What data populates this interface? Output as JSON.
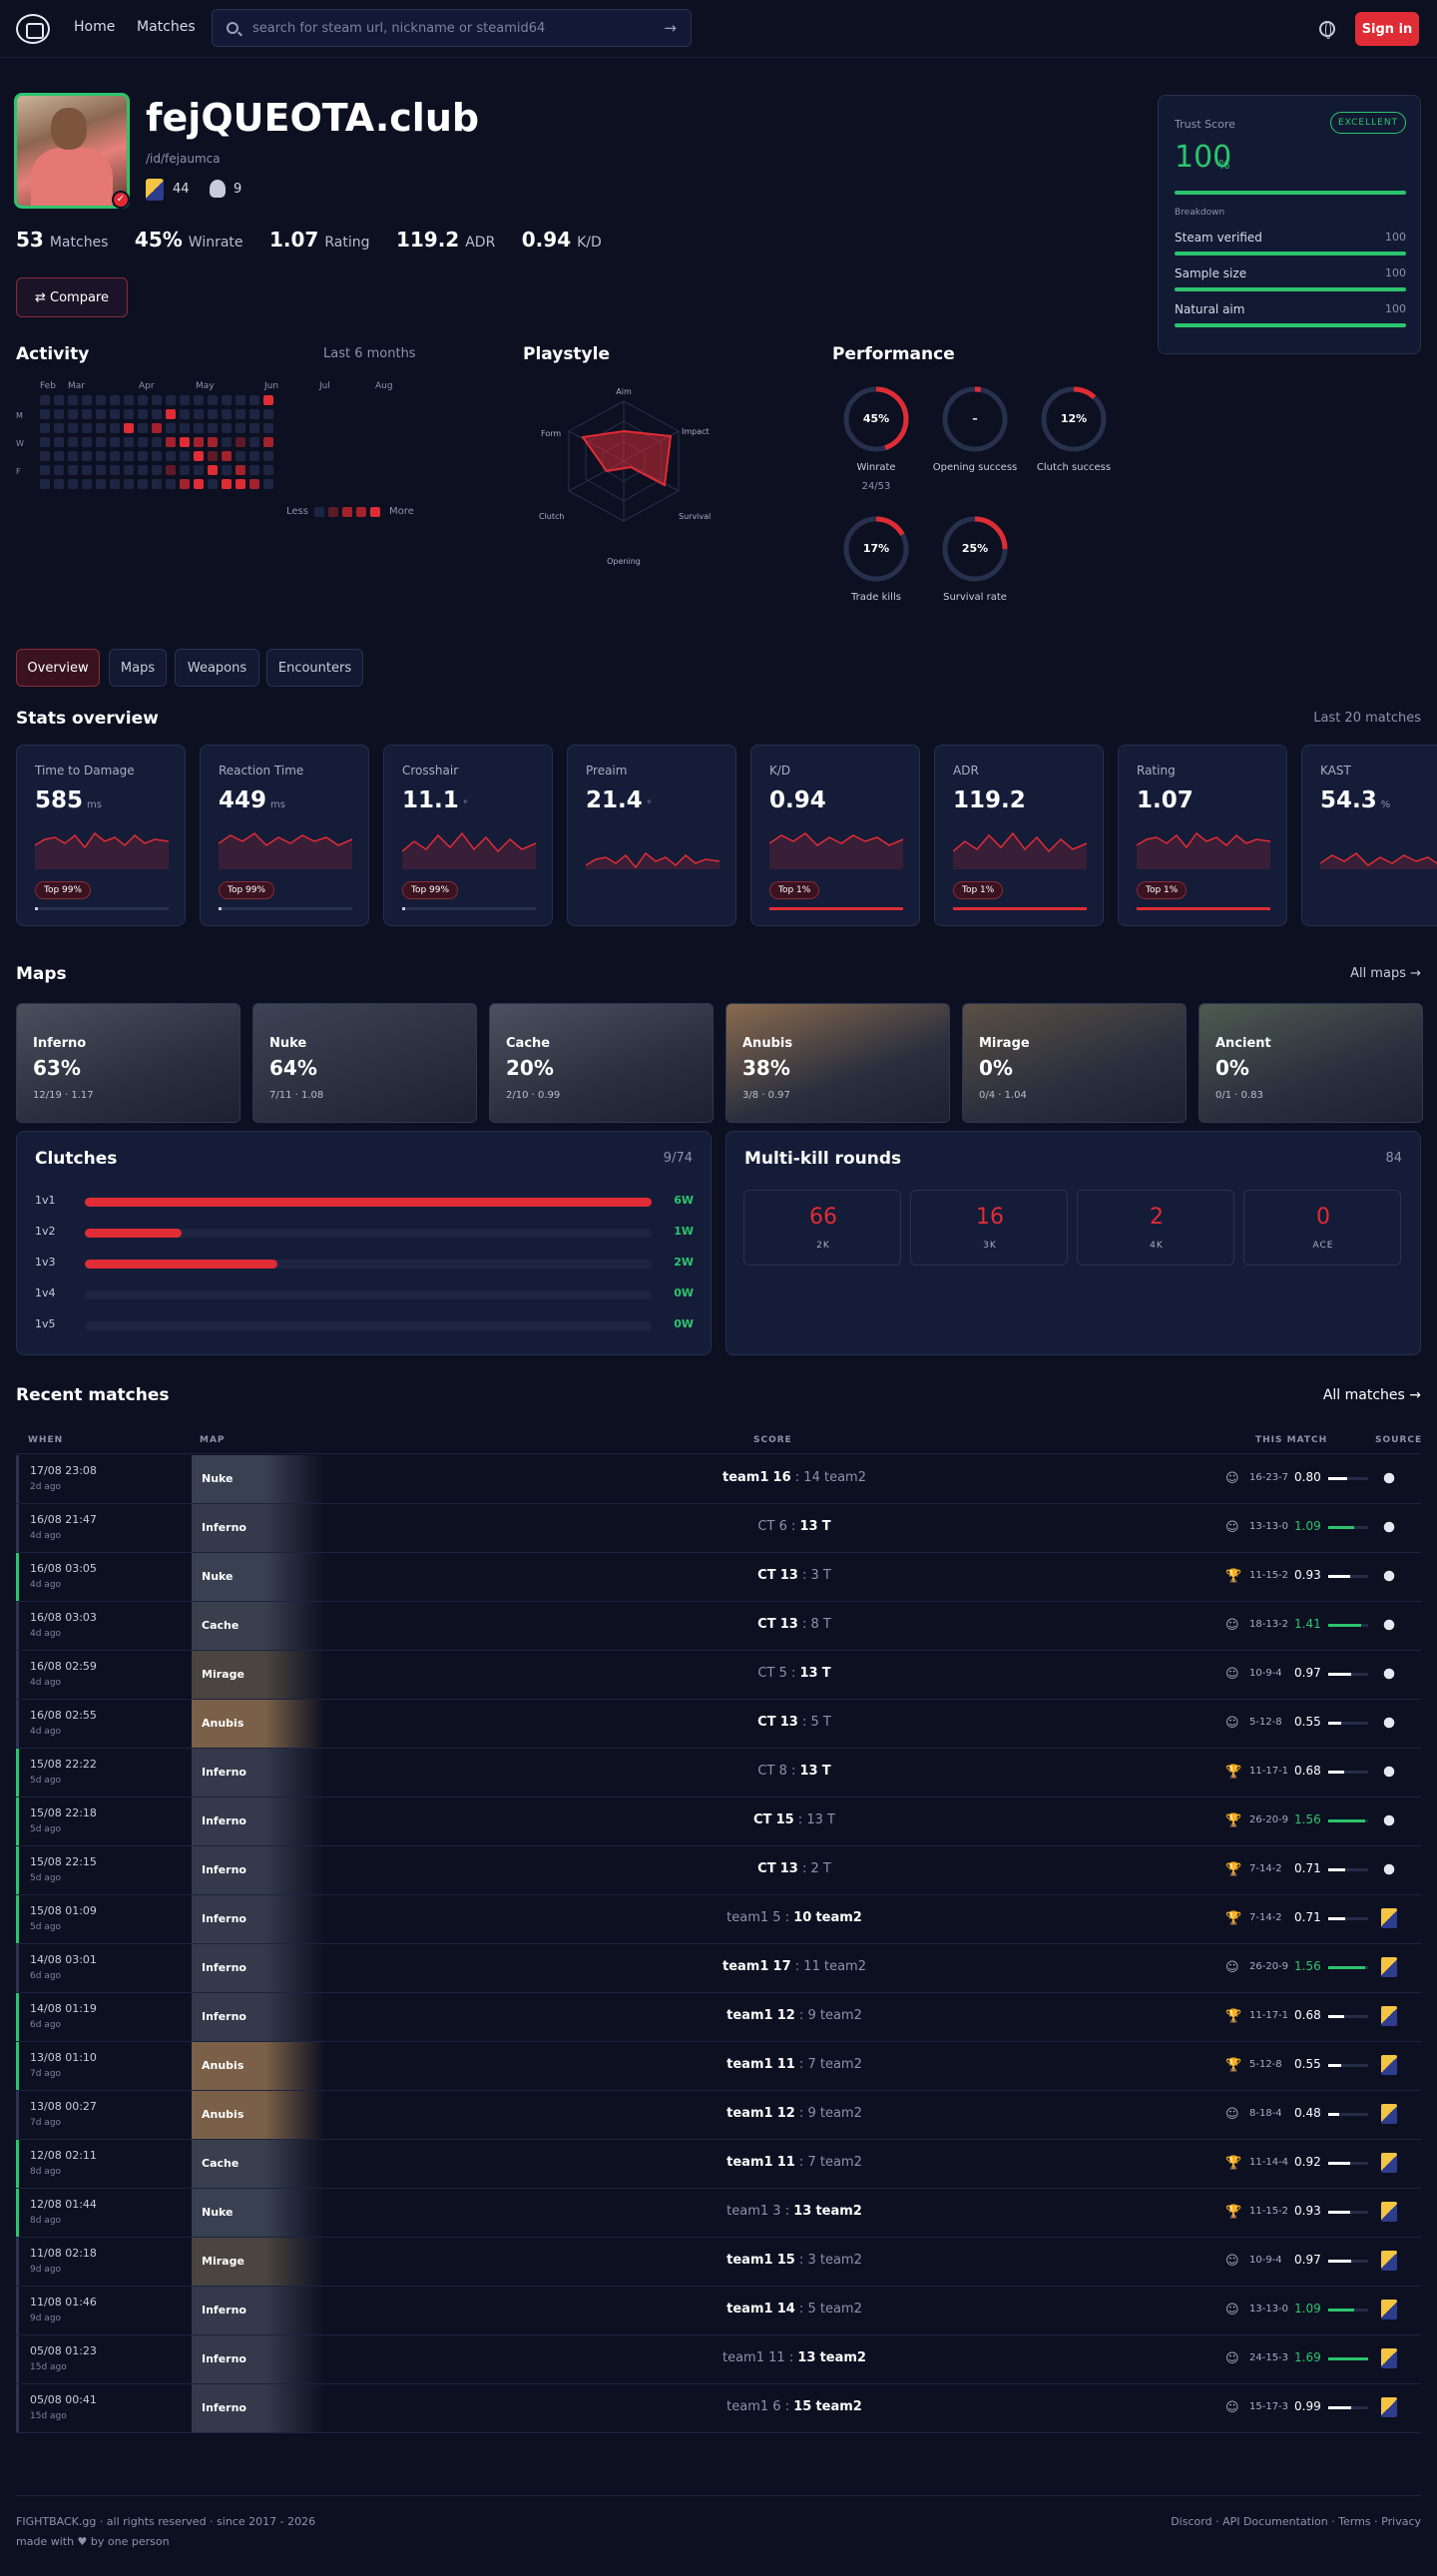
{
  "nav": {
    "home": "Home",
    "matches": "Matches",
    "search_placeholder": "search for steam url, nickname or steamid64",
    "signin": "Sign in"
  },
  "profile": {
    "name": "fejQUEOTA.club",
    "slug": "/id/fejaumca",
    "badge1": "44",
    "badge2": "9",
    "stats": [
      {
        "value": "53",
        "label": "Matches"
      },
      {
        "value": "45%",
        "label": "Winrate"
      },
      {
        "value": "1.07",
        "label": "Rating"
      },
      {
        "value": "119.2",
        "label": "ADR"
      },
      {
        "value": "0.94",
        "label": "K/D"
      }
    ],
    "compare": "Compare"
  },
  "trust": {
    "title": "Trust Score",
    "badge": "EXCELLENT",
    "score": "100",
    "unit": "%",
    "breakdown": "Breakdown",
    "rows": [
      {
        "label": "Steam verified",
        "value": "100"
      },
      {
        "label": "Sample size",
        "value": "100"
      },
      {
        "label": "Natural aim",
        "value": "100"
      }
    ]
  },
  "activity": {
    "title": "Activity",
    "range": "Last 6 months",
    "months": [
      "Feb",
      "Mar",
      "Apr",
      "May",
      "Jun",
      "Jul",
      "Aug"
    ],
    "days": [
      "M",
      "W",
      "F"
    ],
    "less": "Less",
    "more": "More"
  },
  "playstyle": {
    "title": "Playstyle",
    "axes": [
      "Aim",
      "Impact",
      "Survival",
      "Opening",
      "Clutch",
      "Form"
    ]
  },
  "performance": {
    "title": "Performance",
    "rings": [
      {
        "label": "Winrate",
        "value": "45%",
        "pct": 45,
        "sub": "24/53"
      },
      {
        "label": "Opening success",
        "value": "–",
        "pct": 3,
        "sub": ""
      },
      {
        "label": "Clutch success",
        "value": "12%",
        "pct": 12,
        "sub": ""
      },
      {
        "label": "Trade kills",
        "value": "17%",
        "pct": 17,
        "sub": ""
      },
      {
        "label": "Survival rate",
        "value": "25%",
        "pct": 25,
        "sub": ""
      }
    ]
  },
  "tabs": [
    "Overview",
    "Maps",
    "Weapons",
    "Encounters"
  ],
  "stats_overview": {
    "title": "Stats overview",
    "range": "Last 20 matches",
    "cards": [
      {
        "title": "Time to Damage",
        "value": "585",
        "unit": "ms",
        "tag": "Top 99%",
        "fill": 0.02
      },
      {
        "title": "Reaction Time",
        "value": "449",
        "unit": "ms",
        "tag": "Top 99%",
        "fill": 0.02
      },
      {
        "title": "Crosshair",
        "value": "11.1",
        "unit": "°",
        "tag": "Top 99%",
        "fill": 0.02
      },
      {
        "title": "Preaim",
        "value": "21.4",
        "unit": "°",
        "tag": "",
        "fill": 0
      },
      {
        "title": "K/D",
        "value": "0.94",
        "unit": "",
        "tag": "Top 1%",
        "fill": 1
      },
      {
        "title": "ADR",
        "value": "119.2",
        "unit": "",
        "tag": "Top 1%",
        "fill": 1
      },
      {
        "title": "Rating",
        "value": "1.07",
        "unit": "",
        "tag": "Top 1%",
        "fill": 1
      },
      {
        "title": "KAST",
        "value": "54.3",
        "unit": "%",
        "tag": "",
        "fill": 0
      }
    ]
  },
  "maps": {
    "title": "Maps",
    "all": "All maps →",
    "items": [
      {
        "name": "Inferno",
        "pct": "63%",
        "sub": "12/19 · 1.17",
        "color": "#4a4f5c"
      },
      {
        "name": "Nuke",
        "pct": "64%",
        "sub": "7/11 · 1.08",
        "color": "#3c4354"
      },
      {
        "name": "Cache",
        "pct": "20%",
        "sub": "2/10 · 0.99",
        "color": "#4c5160"
      },
      {
        "name": "Anubis",
        "pct": "38%",
        "sub": "3/8 · 0.97",
        "color": "#8a6a4e"
      },
      {
        "name": "Mirage",
        "pct": "0%",
        "sub": "0/4 · 1.04",
        "color": "#5a5044"
      },
      {
        "name": "Ancient",
        "pct": "0%",
        "sub": "0/1 · 0.83",
        "color": "#4e5a50"
      }
    ]
  },
  "clutches": {
    "title": "Clutches",
    "total": "9/74",
    "rows": [
      {
        "label": "1v1",
        "wins": "6W",
        "fill": 1
      },
      {
        "label": "1v2",
        "wins": "1W",
        "fill": 0.17
      },
      {
        "label": "1v3",
        "wins": "2W",
        "fill": 0.34
      },
      {
        "label": "1v4",
        "wins": "0W",
        "fill": 0
      },
      {
        "label": "1v5",
        "wins": "0W",
        "fill": 0
      }
    ]
  },
  "multikill": {
    "title": "Multi-kill rounds",
    "total": "84",
    "items": [
      {
        "value": "66",
        "label": "2K"
      },
      {
        "value": "16",
        "label": "3K"
      },
      {
        "value": "2",
        "label": "4K"
      },
      {
        "value": "0",
        "label": "ACE"
      }
    ]
  },
  "recent": {
    "title": "Recent matches",
    "all": "All matches →",
    "headers": {
      "when": "WHEN",
      "map": "MAP",
      "score": "SCORE",
      "this_match": "THIS MATCH",
      "source": "SOURCE"
    },
    "rows": [
      {
        "date": "17/08 23:08",
        "ago": "2d ago",
        "map": "Nuke",
        "t1": "team1",
        "s1": "16",
        "s2": "14",
        "t2": "team2",
        "w": 1,
        "win": false,
        "icon": "smiley",
        "kda": "16-23-7",
        "rating": "0.80",
        "src": "fb"
      },
      {
        "date": "16/08 21:47",
        "ago": "4d ago",
        "map": "Inferno",
        "t1": "CT",
        "s1": "6",
        "s2": "13",
        "t2": "T",
        "w": 2,
        "win": false,
        "icon": "smiley",
        "kda": "13-13-0",
        "rating": "1.09",
        "src": "fb"
      },
      {
        "date": "16/08 03:05",
        "ago": "4d ago",
        "map": "Nuke",
        "t1": "CT",
        "s1": "13",
        "s2": "3",
        "t2": "T",
        "w": 1,
        "win": true,
        "icon": "trophy",
        "kda": "11-15-2",
        "rating": "0.93",
        "src": "fb"
      },
      {
        "date": "16/08 03:03",
        "ago": "4d ago",
        "map": "Cache",
        "t1": "CT",
        "s1": "13",
        "s2": "8",
        "t2": "T",
        "w": 1,
        "win": false,
        "icon": "smiley",
        "kda": "18-13-2",
        "rating": "1.41",
        "src": "fb"
      },
      {
        "date": "16/08 02:59",
        "ago": "4d ago",
        "map": "Mirage",
        "t1": "CT",
        "s1": "5",
        "s2": "13",
        "t2": "T",
        "w": 2,
        "win": false,
        "icon": "smiley",
        "kda": "10-9-4",
        "rating": "0.97",
        "src": "fb"
      },
      {
        "date": "16/08 02:55",
        "ago": "4d ago",
        "map": "Anubis",
        "t1": "CT",
        "s1": "13",
        "s2": "5",
        "t2": "T",
        "w": 1,
        "win": false,
        "icon": "smiley",
        "kda": "5-12-8",
        "rating": "0.55",
        "src": "fb"
      },
      {
        "date": "15/08 22:22",
        "ago": "5d ago",
        "map": "Inferno",
        "t1": "CT",
        "s1": "8",
        "s2": "13",
        "t2": "T",
        "w": 2,
        "win": true,
        "icon": "trophy",
        "kda": "11-17-1",
        "rating": "0.68",
        "src": "fb"
      },
      {
        "date": "15/08 22:18",
        "ago": "5d ago",
        "map": "Inferno",
        "t1": "CT",
        "s1": "15",
        "s2": "13",
        "t2": "T",
        "w": 1,
        "win": true,
        "icon": "trophy",
        "kda": "26-20-9",
        "rating": "1.56",
        "src": "fb"
      },
      {
        "date": "15/08 22:15",
        "ago": "5d ago",
        "map": "Inferno",
        "t1": "CT",
        "s1": "13",
        "s2": "2",
        "t2": "T",
        "w": 1,
        "win": true,
        "icon": "trophy",
        "kda": "7-14-2",
        "rating": "0.71",
        "src": "fb"
      },
      {
        "date": "15/08 01:09",
        "ago": "5d ago",
        "map": "Inferno",
        "t1": "team1",
        "s1": "5",
        "s2": "10",
        "t2": "team2",
        "w": 2,
        "win": true,
        "icon": "trophy",
        "kda": "7-14-2",
        "rating": "0.71",
        "src": "fc"
      },
      {
        "date": "14/08 03:01",
        "ago": "6d ago",
        "map": "Inferno",
        "t1": "team1",
        "s1": "17",
        "s2": "11",
        "t2": "team2",
        "w": 1,
        "win": false,
        "icon": "smiley",
        "kda": "26-20-9",
        "rating": "1.56",
        "src": "fc"
      },
      {
        "date": "14/08 01:19",
        "ago": "6d ago",
        "map": "Inferno",
        "t1": "team1",
        "s1": "12",
        "s2": "9",
        "t2": "team2",
        "w": 1,
        "win": true,
        "icon": "trophy",
        "kda": "11-17-1",
        "rating": "0.68",
        "src": "fc"
      },
      {
        "date": "13/08 01:10",
        "ago": "7d ago",
        "map": "Anubis",
        "t1": "team1",
        "s1": "11",
        "s2": "7",
        "t2": "team2",
        "w": 1,
        "win": true,
        "icon": "trophy",
        "kda": "5-12-8",
        "rating": "0.55",
        "src": "fc"
      },
      {
        "date": "13/08 00:27",
        "ago": "7d ago",
        "map": "Anubis",
        "t1": "team1",
        "s1": "12",
        "s2": "9",
        "t2": "team2",
        "w": 1,
        "win": false,
        "icon": "smiley",
        "kda": "8-18-4",
        "rating": "0.48",
        "src": "fc"
      },
      {
        "date": "12/08 02:11",
        "ago": "8d ago",
        "map": "Cache",
        "t1": "team1",
        "s1": "11",
        "s2": "7",
        "t2": "team2",
        "w": 1,
        "win": true,
        "icon": "trophy",
        "kda": "11-14-4",
        "rating": "0.92",
        "src": "fc"
      },
      {
        "date": "12/08 01:44",
        "ago": "8d ago",
        "map": "Nuke",
        "t1": "team1",
        "s1": "3",
        "s2": "13",
        "t2": "team2",
        "w": 2,
        "win": true,
        "icon": "trophy",
        "kda": "11-15-2",
        "rating": "0.93",
        "src": "fc"
      },
      {
        "date": "11/08 02:18",
        "ago": "9d ago",
        "map": "Mirage",
        "t1": "team1",
        "s1": "15",
        "s2": "3",
        "t2": "team2",
        "w": 1,
        "win": false,
        "icon": "smiley",
        "kda": "10-9-4",
        "rating": "0.97",
        "src": "fc"
      },
      {
        "date": "11/08 01:46",
        "ago": "9d ago",
        "map": "Inferno",
        "t1": "team1",
        "s1": "14",
        "s2": "5",
        "t2": "team2",
        "w": 1,
        "win": false,
        "icon": "smiley",
        "kda": "13-13-0",
        "rating": "1.09",
        "src": "fc"
      },
      {
        "date": "05/08 01:23",
        "ago": "15d ago",
        "map": "Inferno",
        "t1": "team1",
        "s1": "11",
        "s2": "13",
        "t2": "team2",
        "w": 2,
        "win": false,
        "icon": "smiley",
        "kda": "24-15-3",
        "rating": "1.69",
        "src": "fc"
      },
      {
        "date": "05/08 00:41",
        "ago": "15d ago",
        "map": "Inferno",
        "t1": "team1",
        "s1": "6",
        "s2": "15",
        "t2": "team2",
        "w": 2,
        "win": false,
        "icon": "smiley",
        "kda": "15-17-3",
        "rating": "0.99",
        "src": "fc"
      }
    ]
  },
  "footer": {
    "line1": "FIGHTBACK.gg · all rights reserved · since 2017 - 2026",
    "line2": "made with ♥ by one person",
    "links": [
      "Discord",
      "·",
      "API Documentation",
      "·",
      "Terms",
      "·",
      "Privacy"
    ]
  },
  "colors": {
    "accent": "#e02c35",
    "success": "#2cc46d",
    "bg": "#0c1021",
    "card": "#141c38"
  }
}
